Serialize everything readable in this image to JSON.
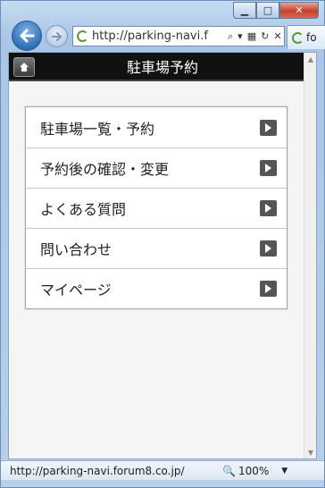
{
  "window": {
    "minimize_glyph": "▁",
    "maximize_glyph": "□",
    "close_glyph": "✕"
  },
  "address_bar": {
    "url": "http://parking-navi.f"
  },
  "tab": {
    "label": "fo"
  },
  "page": {
    "title": "駐車場予約",
    "menu_items": [
      {
        "label": "駐車場一覧・予約"
      },
      {
        "label": "予約後の確認・変更"
      },
      {
        "label": "よくある質問"
      },
      {
        "label": "問い合わせ"
      },
      {
        "label": "マイページ"
      }
    ]
  },
  "status_bar": {
    "url": "http://parking-navi.forum8.co.jp/",
    "zoom": "100%"
  },
  "colors": {
    "header_bg": "#111111",
    "accent_blue": "#2e6fb3",
    "arrow_bg": "#555555"
  }
}
